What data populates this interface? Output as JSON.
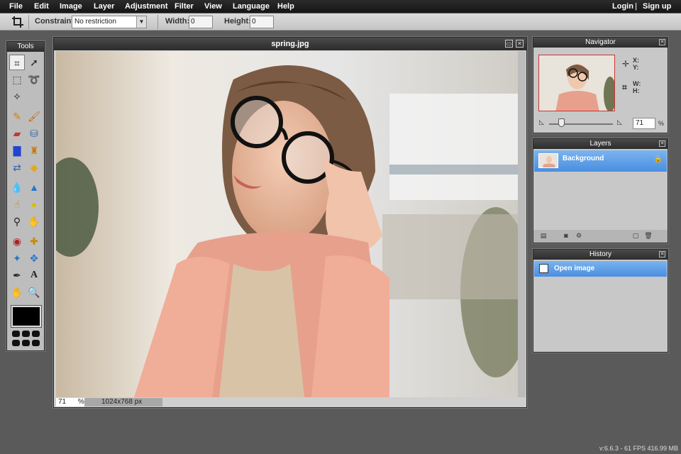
{
  "menu": {
    "items": [
      "File",
      "Edit",
      "Image",
      "Layer",
      "Adjustment",
      "Filter",
      "View",
      "Language",
      "Help"
    ],
    "login": "Login",
    "separator": "|",
    "signup": "Sign up"
  },
  "options": {
    "crop_icon": "crop-icon",
    "constraint_label": "Constraint:",
    "constraint_value": "No restriction",
    "width_label": "Width:",
    "width_value": "0",
    "height_label": "Height:",
    "height_value": "0"
  },
  "tools": {
    "title": "Tools",
    "items": [
      "crop-icon",
      "move-icon",
      "marquee-select-icon",
      "lasso-icon",
      "magic-wand-icon",
      "pencil-icon",
      "brush-icon",
      "eraser-icon",
      "paint-bucket-icon",
      "gradient-icon",
      "clone-stamp-icon",
      "color-replace-icon",
      "draw-shapes-icon",
      "blur-icon",
      "sharpen-icon",
      "smudge-icon",
      "sponge-icon",
      "dodge-icon",
      "burn-icon",
      "red-eye-icon",
      "spot-heal-icon",
      "bloat-icon",
      "pinch-icon",
      "color-picker-icon",
      "type-icon",
      "hand-icon",
      "zoom-icon"
    ],
    "foreground_color": "#000000"
  },
  "image_window": {
    "title": "spring.jpg",
    "zoom": "71",
    "zoom_unit": "%",
    "dimensions": "1024x768 px"
  },
  "navigator": {
    "title": "Navigator",
    "x_label": "X:",
    "y_label": "Y:",
    "w_label": "W:",
    "h_label": "H:",
    "zoom_value": "71",
    "zoom_unit": "%"
  },
  "layers": {
    "title": "Layers",
    "items": [
      {
        "name": "Background"
      }
    ]
  },
  "history": {
    "title": "History",
    "items": [
      {
        "label": "Open image"
      }
    ]
  },
  "status": {
    "text": "v:6.6.3 - 61 FPS 416.99 MB"
  },
  "colors": {
    "selection_blue": "#5b9be6",
    "panel_bg": "#c8c8c8",
    "workspace_bg": "#5a5a5a"
  }
}
